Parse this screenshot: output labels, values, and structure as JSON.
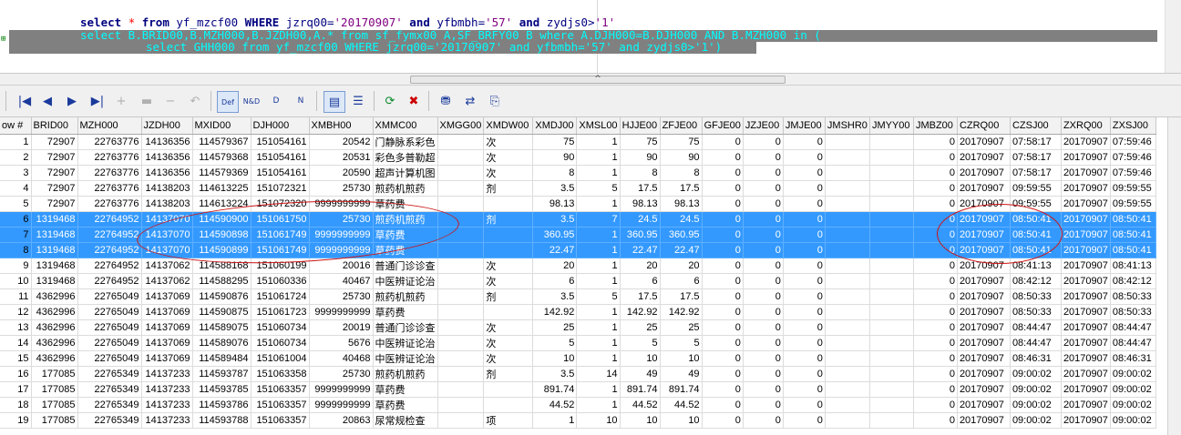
{
  "editor": {
    "line1": {
      "kw_select": "select",
      "star": "*",
      "kw_from": "from",
      "t1": " yf_mzcf00 ",
      "kw_where": "WHERE",
      "t2": " jzrq00=",
      "s1": "'20170907'",
      "kw_and1": " and ",
      "t3": "yfbmbh=",
      "s2": "'57'",
      "kw_and2": " and ",
      "t4": "zydjs0>",
      "s3": "'1'"
    },
    "line2": "select B.BRID00,B.MZH000,B.JZDH00,A.* from sf_fymx00 A,SF_BRFY00 B where A.DJH000=B.DJH000 AND B.MZH000 in (",
    "line3": "select GHH000 from yf_mzcf00 WHERE jzrq00='20170907' and yfbmbh='57' and zydjs0>'1')"
  },
  "splitter_glyph": "^",
  "toolbar": {
    "first": "|◀",
    "prev": "◀",
    "next": "▶",
    "last": "▶|",
    "add": "+",
    "edit": "▬",
    "delete": "−",
    "undo": "↶",
    "def": "Def",
    "nd": "N&D",
    "d": "D",
    "n": "N",
    "grid_view": "▤",
    "form_view": "☰",
    "refresh": "⟳",
    "cancel": "✖",
    "filter": "⛃",
    "export": "⇄",
    "copy": "⎘"
  },
  "columns": [
    "ow #",
    "BRID00",
    "MZH000",
    "JZDH00",
    "MXID00",
    "DJH000",
    "XMBH00",
    "XMMC00",
    "XMGG00",
    "XMDW00",
    "XMDJ00",
    "XMSL00",
    "HJJE00",
    "ZFJE00",
    "GFJE00",
    "JZJE00",
    "JMJE00",
    "JMSHR0",
    "JMYY00",
    "JMBZ00",
    "CZRQ00",
    "CZSJ00",
    "ZXRQ00",
    "ZXSJ00"
  ],
  "rows": [
    [
      "1",
      "72907",
      "22763776",
      "14136356",
      "114579367",
      "151054161",
      "20542",
      "门静脉系彩色",
      "",
      "次",
      "75",
      "1",
      "75",
      "75",
      "0",
      "0",
      "0",
      "",
      "",
      "0",
      "20170907",
      "07:58:17",
      "20170907",
      "07:59:46"
    ],
    [
      "2",
      "72907",
      "22763776",
      "14136356",
      "114579368",
      "151054161",
      "20531",
      "彩色多普勒超",
      "",
      "次",
      "90",
      "1",
      "90",
      "90",
      "0",
      "0",
      "0",
      "",
      "",
      "0",
      "20170907",
      "07:58:17",
      "20170907",
      "07:59:46"
    ],
    [
      "3",
      "72907",
      "22763776",
      "14136356",
      "114579369",
      "151054161",
      "20590",
      "超声计算机图",
      "",
      "次",
      "8",
      "1",
      "8",
      "8",
      "0",
      "0",
      "0",
      "",
      "",
      "0",
      "20170907",
      "07:58:17",
      "20170907",
      "07:59:46"
    ],
    [
      "4",
      "72907",
      "22763776",
      "14138203",
      "114613225",
      "151072321",
      "25730",
      "煎药机煎药",
      "",
      "剂",
      "3.5",
      "5",
      "17.5",
      "17.5",
      "0",
      "0",
      "0",
      "",
      "",
      "0",
      "20170907",
      "09:59:55",
      "20170907",
      "09:59:55"
    ],
    [
      "5",
      "72907",
      "22763776",
      "14138203",
      "114613224",
      "151072320",
      "9999999999",
      "草药费",
      "",
      "",
      "98.13",
      "1",
      "98.13",
      "98.13",
      "0",
      "0",
      "0",
      "",
      "",
      "0",
      "20170907",
      "09:59:55",
      "20170907",
      "09:59:55"
    ],
    [
      "6",
      "1319468",
      "22764952",
      "14137070",
      "114590900",
      "151061750",
      "25730",
      "煎药机煎药",
      "",
      "剂",
      "3.5",
      "7",
      "24.5",
      "24.5",
      "0",
      "0",
      "0",
      "",
      "",
      "0",
      "20170907",
      "08:50:41",
      "20170907",
      "08:50:41"
    ],
    [
      "7",
      "1319468",
      "22764952",
      "14137070",
      "114590898",
      "151061749",
      "9999999999",
      "草药费",
      "",
      "",
      "360.95",
      "1",
      "360.95",
      "360.95",
      "0",
      "0",
      "0",
      "",
      "",
      "0",
      "20170907",
      "08:50:41",
      "20170907",
      "08:50:41"
    ],
    [
      "8",
      "1319468",
      "22764952",
      "14137070",
      "114590899",
      "151061749",
      "9999999999",
      "草药费",
      "",
      "",
      "22.47",
      "1",
      "22.47",
      "22.47",
      "0",
      "0",
      "0",
      "",
      "",
      "0",
      "20170907",
      "08:50:41",
      "20170907",
      "08:50:41"
    ],
    [
      "9",
      "1319468",
      "22764952",
      "14137062",
      "114588168",
      "151060199",
      "20016",
      "普通门诊诊查",
      "",
      "次",
      "20",
      "1",
      "20",
      "20",
      "0",
      "0",
      "0",
      "",
      "",
      "0",
      "20170907",
      "08:41:13",
      "20170907",
      "08:41:13"
    ],
    [
      "10",
      "1319468",
      "22764952",
      "14137062",
      "114588295",
      "151060336",
      "40467",
      "中医辨证论治",
      "",
      "次",
      "6",
      "1",
      "6",
      "6",
      "0",
      "0",
      "0",
      "",
      "",
      "0",
      "20170907",
      "08:42:12",
      "20170907",
      "08:42:12"
    ],
    [
      "11",
      "4362996",
      "22765049",
      "14137069",
      "114590876",
      "151061724",
      "25730",
      "煎药机煎药",
      "",
      "剂",
      "3.5",
      "5",
      "17.5",
      "17.5",
      "0",
      "0",
      "0",
      "",
      "",
      "0",
      "20170907",
      "08:50:33",
      "20170907",
      "08:50:33"
    ],
    [
      "12",
      "4362996",
      "22765049",
      "14137069",
      "114590875",
      "151061723",
      "9999999999",
      "草药费",
      "",
      "",
      "142.92",
      "1",
      "142.92",
      "142.92",
      "0",
      "0",
      "0",
      "",
      "",
      "0",
      "20170907",
      "08:50:33",
      "20170907",
      "08:50:33"
    ],
    [
      "13",
      "4362996",
      "22765049",
      "14137069",
      "114589075",
      "151060734",
      "20019",
      "普通门诊诊查",
      "",
      "次",
      "25",
      "1",
      "25",
      "25",
      "0",
      "0",
      "0",
      "",
      "",
      "0",
      "20170907",
      "08:44:47",
      "20170907",
      "08:44:47"
    ],
    [
      "14",
      "4362996",
      "22765049",
      "14137069",
      "114589076",
      "151060734",
      "5676",
      "中医辨证论治",
      "",
      "次",
      "5",
      "1",
      "5",
      "5",
      "0",
      "0",
      "0",
      "",
      "",
      "0",
      "20170907",
      "08:44:47",
      "20170907",
      "08:44:47"
    ],
    [
      "15",
      "4362996",
      "22765049",
      "14137069",
      "114589484",
      "151061004",
      "40468",
      "中医辨证论治",
      "",
      "次",
      "10",
      "1",
      "10",
      "10",
      "0",
      "0",
      "0",
      "",
      "",
      "0",
      "20170907",
      "08:46:31",
      "20170907",
      "08:46:31"
    ],
    [
      "16",
      "177085",
      "22765349",
      "14137233",
      "114593787",
      "151063358",
      "25730",
      "煎药机煎药",
      "",
      "剂",
      "3.5",
      "14",
      "49",
      "49",
      "0",
      "0",
      "0",
      "",
      "",
      "0",
      "20170907",
      "09:00:02",
      "20170907",
      "09:00:02"
    ],
    [
      "17",
      "177085",
      "22765349",
      "14137233",
      "114593785",
      "151063357",
      "9999999999",
      "草药费",
      "",
      "",
      "891.74",
      "1",
      "891.74",
      "891.74",
      "0",
      "0",
      "0",
      "",
      "",
      "0",
      "20170907",
      "09:00:02",
      "20170907",
      "09:00:02"
    ],
    [
      "18",
      "177085",
      "22765349",
      "14137233",
      "114593786",
      "151063357",
      "9999999999",
      "草药费",
      "",
      "",
      "44.52",
      "1",
      "44.52",
      "44.52",
      "0",
      "0",
      "0",
      "",
      "",
      "0",
      "20170907",
      "09:00:02",
      "20170907",
      "09:00:02"
    ],
    [
      "19",
      "177085",
      "22765349",
      "14137233",
      "114593788",
      "151063357",
      "20863",
      "尿常规检查",
      "",
      "项",
      "1",
      "10",
      "10",
      "10",
      "0",
      "0",
      "0",
      "",
      "",
      "0",
      "20170907",
      "09:00:02",
      "20170907",
      "09:00:02"
    ]
  ],
  "selected_rows": [
    6,
    7,
    8
  ],
  "colors": {
    "selection": "#3399ff",
    "annotation": "#cc1414",
    "sql_highlight": "#808080",
    "sql_text": "#00ffff"
  }
}
